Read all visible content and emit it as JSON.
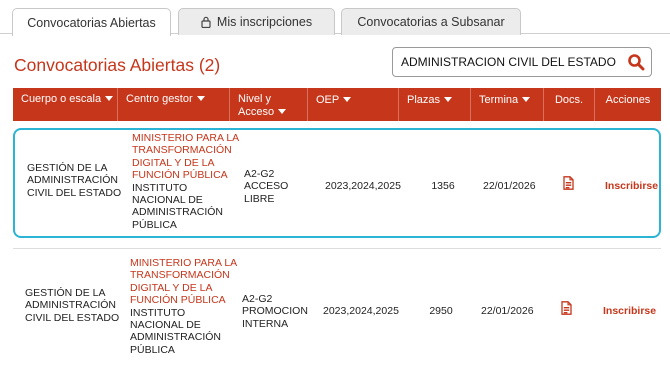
{
  "tabs": [
    {
      "label": "Convocatorias Abiertas"
    },
    {
      "label": "Mis inscripciones"
    },
    {
      "label": "Convocatorias a Subsanar"
    }
  ],
  "page_title": "Convocatorias Abiertas (2)",
  "search": {
    "value": "ADMINISTRACION CIVIL DEL ESTADO"
  },
  "table": {
    "headers": {
      "cuerpo": "Cuerpo o escala",
      "centro": "Centro gestor",
      "nivel": "Nivel y Acceso",
      "oep": "OEP",
      "plazas": "Plazas",
      "termina": "Termina",
      "docs": "Docs.",
      "acciones": "Acciones"
    },
    "rows": [
      {
        "cuerpo": "GESTIÓN DE LA ADMINISTRACIÓN CIVIL DEL ESTADO",
        "ministerio": "MINISTERIO PARA LA TRANSFORMACIÓN DIGITAL Y DE LA FUNCIÓN PÚBLICA",
        "instituto": "INSTITUTO NACIONAL DE ADMINISTRACIÓN PÚBLICA",
        "nivel": "A2-G2 ACCESO LIBRE",
        "oep": "2023,2024,2025",
        "plazas": "1356",
        "termina": "22/01/2026",
        "accion": "Inscribirse"
      },
      {
        "cuerpo": "GESTIÓN DE LA ADMINISTRACIÓN CIVIL DEL ESTADO",
        "ministerio": "MINISTERIO PARA LA TRANSFORMACIÓN DIGITAL Y DE LA FUNCIÓN PÚBLICA",
        "instituto": "INSTITUTO NACIONAL DE ADMINISTRACIÓN PÚBLICA",
        "nivel": "A2-G2 PROMOCION INTERNA",
        "oep": "2023,2024,2025",
        "plazas": "2950",
        "termina": "22/01/2026",
        "accion": "Inscribirse"
      }
    ]
  },
  "colors": {
    "accent": "#c6361b",
    "highlight": "#2bb4d3"
  },
  "icons": {
    "tab2": "lock-icon",
    "search": "search-icon",
    "docs": "pdf-document-icon"
  }
}
